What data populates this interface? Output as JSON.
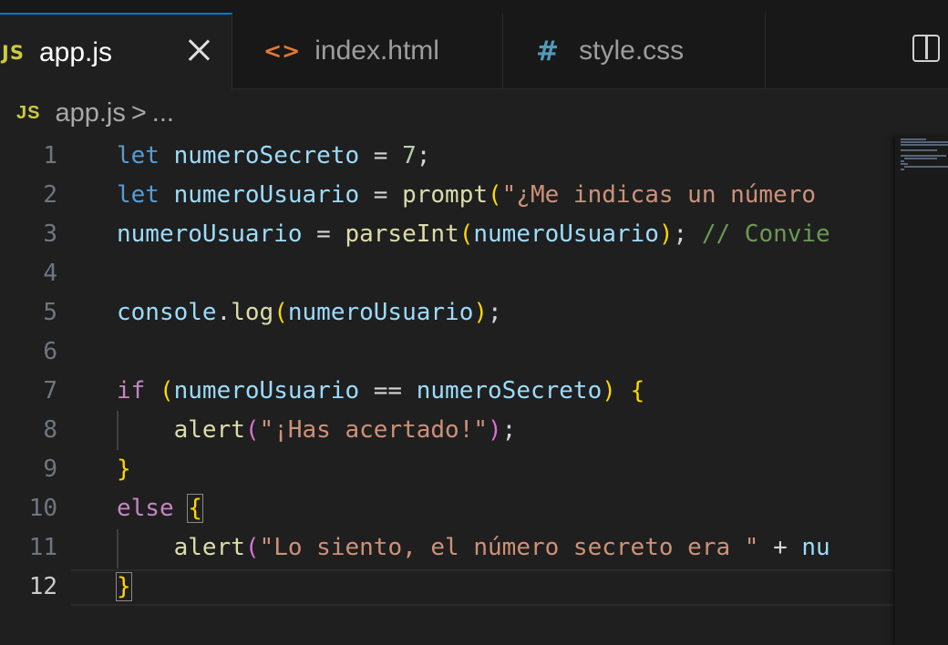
{
  "tabs": [
    {
      "icon": "JS",
      "label": "app.js",
      "active": true,
      "closable": true
    },
    {
      "icon": "<>",
      "label": "index.html",
      "active": false
    },
    {
      "icon": "#",
      "label": "style.css",
      "active": false
    }
  ],
  "breadcrumb": {
    "icon": "JS",
    "file": "app.js",
    "separator": ">",
    "rest": "..."
  },
  "line_numbers": [
    "1",
    "2",
    "3",
    "4",
    "5",
    "6",
    "7",
    "8",
    "9",
    "10",
    "11",
    "12"
  ],
  "current_line": 12,
  "code": {
    "l1": {
      "kw": "let",
      "var": "numeroSecreto",
      "op": "=",
      "num": "7",
      "end": ";"
    },
    "l2": {
      "kw": "let",
      "var": "numeroUsuario",
      "op": "=",
      "fn": "prompt",
      "open": "(",
      "str": "\"¿Me indicas un número"
    },
    "l3": {
      "var": "numeroUsuario",
      "op": "=",
      "fn": "parseInt",
      "open": "(",
      "arg": "numeroUsuario",
      "close": ")",
      "end": ";",
      "comment": "// Convie"
    },
    "l5": {
      "obj": "console",
      "dot": ".",
      "fn": "log",
      "open": "(",
      "arg": "numeroUsuario",
      "close": ")",
      "end": ";"
    },
    "l7": {
      "kw": "if",
      "open": "(",
      "a": "numeroUsuario",
      "op": "==",
      "b": "numeroSecreto",
      "close": ")",
      "brace": "{"
    },
    "l8": {
      "fn": "alert",
      "open": "(",
      "str": "\"¡Has acertado!\"",
      "close": ")",
      "end": ";"
    },
    "l9": {
      "brace": "}"
    },
    "l10": {
      "kw": "else",
      "brace": "{"
    },
    "l11": {
      "fn": "alert",
      "open": "(",
      "str": "\"Lo siento, el número secreto era \"",
      "op": "+",
      "tail": "nu"
    },
    "l12": {
      "brace": "}"
    }
  },
  "colors": {
    "accent": "#0078d4",
    "js_icon": "#cbcb41",
    "html_icon": "#e37933",
    "css_icon": "#519aba"
  },
  "icons": {
    "close": "close-icon",
    "split": "split-editor-icon"
  }
}
